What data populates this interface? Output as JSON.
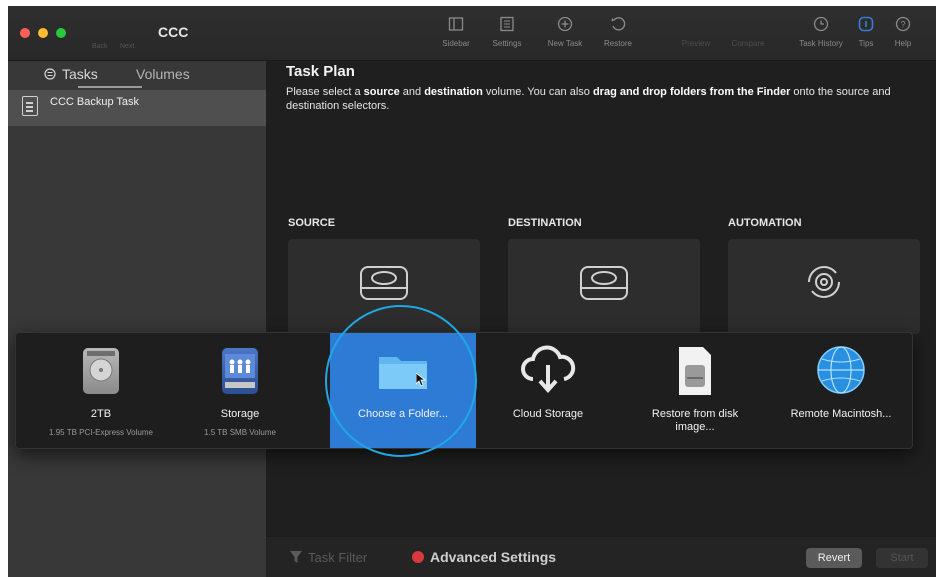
{
  "window": {
    "title": "CCC",
    "nav_back": "Back",
    "nav_next": "Next"
  },
  "toolbar": {
    "items": [
      {
        "label": "Sidebar",
        "icon": "sidebar-icon"
      },
      {
        "label": "Settings",
        "icon": "settings-icon"
      },
      {
        "label": "New Task",
        "icon": "plus-circle-icon"
      },
      {
        "label": "Restore",
        "icon": "restore-icon"
      },
      {
        "label": "Preview",
        "icon": "preview-icon"
      },
      {
        "label": "Compare",
        "icon": "compare-icon"
      },
      {
        "label": "Task History",
        "icon": "clock-icon"
      },
      {
        "label": "Tips",
        "icon": "tips-icon"
      },
      {
        "label": "Help",
        "icon": "help-icon"
      }
    ]
  },
  "sidebar": {
    "tabs": [
      "Tasks",
      "Volumes"
    ],
    "selected_tab": "Tasks",
    "tasks": [
      {
        "label": "CCC Backup Task"
      }
    ]
  },
  "main": {
    "title": "Task Plan",
    "instructions": {
      "p1": "Please select a ",
      "b1": "source",
      "p2": " and ",
      "b2": "destination",
      "p3": " volume. You can also ",
      "b3": "drag and drop folders from the Finder",
      "p4": " onto the source and destination selectors."
    },
    "columns": [
      "SOURCE",
      "DESTINATION",
      "AUTOMATION"
    ]
  },
  "popup": {
    "options": [
      {
        "label": "2TB",
        "sub": "1.95 TB PCI-Express Volume",
        "icon": "hard-drive-icon"
      },
      {
        "label": "Storage",
        "sub": "1.5 TB SMB Volume",
        "icon": "network-volume-icon"
      },
      {
        "label": "Choose a Folder...",
        "icon": "folder-icon",
        "selected": true
      },
      {
        "label": "Cloud Storage",
        "icon": "cloud-download-icon"
      },
      {
        "label": "Restore from disk image...",
        "icon": "disk-image-icon"
      },
      {
        "label": "Remote Macintosh...",
        "icon": "globe-icon"
      }
    ]
  },
  "bottom_bar": {
    "filter": "Task Filter",
    "advanced": "Advanced Settings",
    "revert": "Revert",
    "start": "Start"
  },
  "colors": {
    "accent": "#2e7bd6",
    "highlight_circle": "#1fa7e6",
    "advanced_gear": "#d9383f"
  }
}
